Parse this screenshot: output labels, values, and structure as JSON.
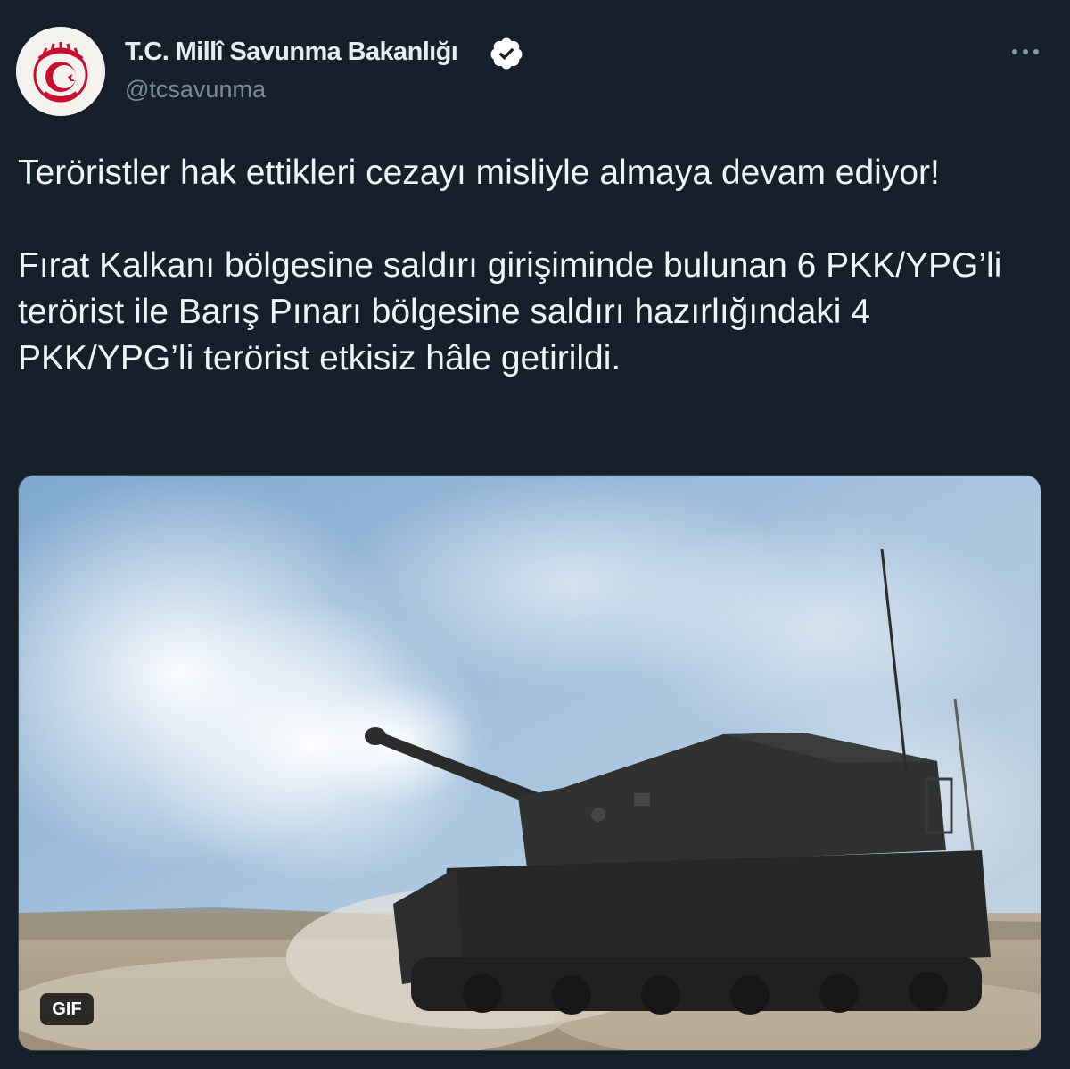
{
  "author": {
    "name": "T.C. Millî Savunma Bakanlığı",
    "handle": "@tcsavunma",
    "verified": true,
    "avatar_icon": "ministry-emblem-icon"
  },
  "tweet": {
    "paragraphs": [
      "Teröristler hak ettikleri cezayı misliyle almaya devam ediyor!",
      "Fırat Kalkanı bölgesine saldırı girişiminde bulunan 6 PKK/YPG’li terörist ile Barış Pınarı bölgesine saldırı hazırlığındaki 4 PKK/YPG’li terörist etkisiz hâle getirildi."
    ]
  },
  "media": {
    "type": "gif",
    "badge_label": "GIF",
    "description_icon": "self-propelled-howitzer-firing"
  },
  "colors": {
    "background": "#15202b",
    "text": "#f0f3f5",
    "secondary_text": "#7d8a96",
    "verified_badge": "#ffffff",
    "emblem_red": "#c8102e"
  }
}
